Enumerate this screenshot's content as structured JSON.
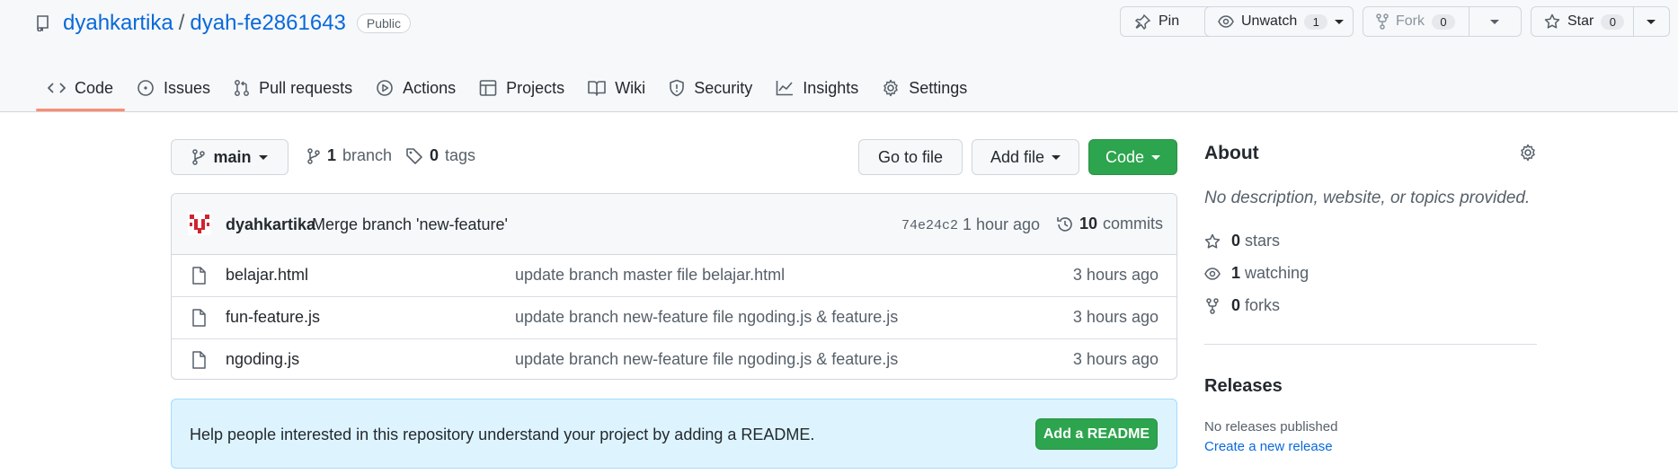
{
  "repo": {
    "owner": "dyahkartika",
    "separator": "/",
    "name": "dyah-fe2861643",
    "visibility": "Public"
  },
  "header_actions": {
    "pin": "Pin",
    "unwatch": "Unwatch",
    "watch_count": "1",
    "fork": "Fork",
    "fork_count": "0",
    "star": "Star",
    "star_count": "0"
  },
  "tabs": [
    {
      "label": "Code",
      "icon": "code-icon"
    },
    {
      "label": "Issues",
      "icon": "issue-icon"
    },
    {
      "label": "Pull requests",
      "icon": "pull-request-icon"
    },
    {
      "label": "Actions",
      "icon": "play-icon"
    },
    {
      "label": "Projects",
      "icon": "table-icon"
    },
    {
      "label": "Wiki",
      "icon": "book-icon"
    },
    {
      "label": "Security",
      "icon": "shield-icon"
    },
    {
      "label": "Insights",
      "icon": "graph-icon"
    },
    {
      "label": "Settings",
      "icon": "gear-icon"
    }
  ],
  "toolbar": {
    "branch": "main",
    "branch_count": "1",
    "branch_label": "branch",
    "tag_count": "0",
    "tag_label": "tags",
    "go_to_file": "Go to file",
    "add_file": "Add file",
    "code": "Code"
  },
  "latest_commit": {
    "author": "dyahkartika",
    "message": "Merge branch 'new-feature'",
    "sha": "74e24c2",
    "time": "1 hour ago",
    "commit_count": "10",
    "commit_label": "commits"
  },
  "files": [
    {
      "name": "belajar.html",
      "message": "update branch master file belajar.html",
      "age": "3 hours ago"
    },
    {
      "name": "fun-feature.js",
      "message": "update branch new-feature file ngoding.js & feature.js",
      "age": "3 hours ago"
    },
    {
      "name": "ngoding.js",
      "message": "update branch new-feature file ngoding.js & feature.js",
      "age": "3 hours ago"
    }
  ],
  "readme_banner": {
    "text": "Help people interested in this repository understand your project by adding a README.",
    "button": "Add a README"
  },
  "about": {
    "title": "About",
    "description": "No description, website, or topics provided.",
    "stars_count": "0",
    "stars_label": "stars",
    "watching_count": "1",
    "watching_label": "watching",
    "forks_count": "0",
    "forks_label": "forks"
  },
  "releases": {
    "title": "Releases",
    "none": "No releases published",
    "create": "Create a new release"
  },
  "colors": {
    "link": "#0969da",
    "primary_button": "#2da44e",
    "active_tab_underline": "#fd8c73",
    "banner_bg": "#ddf4ff"
  }
}
